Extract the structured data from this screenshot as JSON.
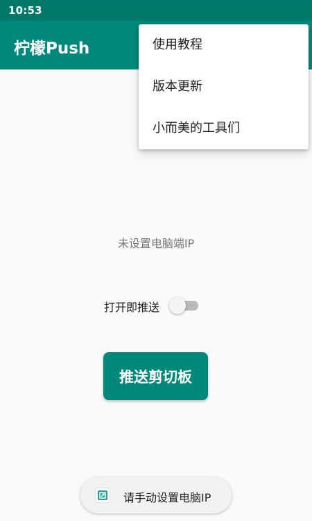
{
  "status_bar": {
    "time": "10:53"
  },
  "app_bar": {
    "title": "柠檬Push"
  },
  "overflow_menu": {
    "items": [
      {
        "label": "使用教程"
      },
      {
        "label": "版本更新"
      },
      {
        "label": "小而美的工具们"
      }
    ]
  },
  "main": {
    "ip_status": "未设置电脑端IP",
    "toggle": {
      "label": "打开即推送",
      "on": false
    },
    "push_button_label": "推送剪切板"
  },
  "toast": {
    "icon": "app-icon",
    "message": "请手动设置电脑IP"
  },
  "colors": {
    "primary": "#00897b",
    "primary_dark": "#00796b",
    "background": "#fafafa"
  }
}
